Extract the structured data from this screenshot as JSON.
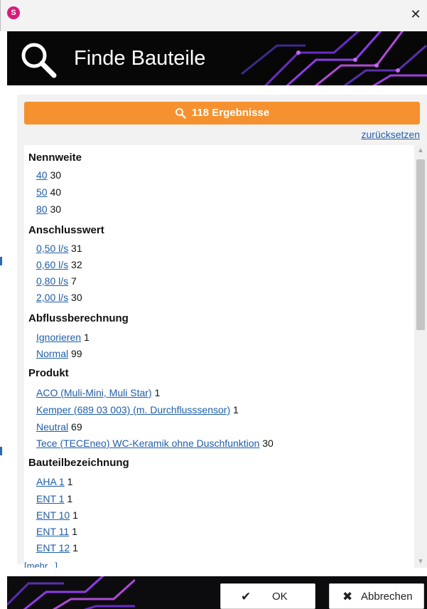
{
  "window": {
    "app_icon_letter": "S",
    "close_glyph": "✕"
  },
  "banner": {
    "title": "Finde Bauteile",
    "icon": "search-icon"
  },
  "results": {
    "label": "118 Ergebnisse",
    "icon": "search-icon",
    "color": "#f5922f"
  },
  "reset_label": "zurücksetzen",
  "groups": [
    {
      "title": "Nennweite",
      "items": [
        {
          "link": "40",
          "count": "30"
        },
        {
          "link": "50",
          "count": "40"
        },
        {
          "link": "80",
          "count": "30"
        }
      ]
    },
    {
      "title": "Anschlusswert",
      "items": [
        {
          "link": "0,50 l/s",
          "count": "31"
        },
        {
          "link": "0,60 l/s",
          "count": "32"
        },
        {
          "link": "0,80 l/s",
          "count": "7"
        },
        {
          "link": "2,00 l/s",
          "count": "30"
        }
      ]
    },
    {
      "title": "Abflussberechnung",
      "items": [
        {
          "link": "Ignorieren",
          "count": "1"
        },
        {
          "link": "Normal",
          "count": "99"
        }
      ]
    },
    {
      "title": "Produkt",
      "items": [
        {
          "link": "ACO (Muli-Mini, Muli Star)",
          "count": "1"
        },
        {
          "link": "Kemper (689 03 003) (m. Durchflusssensor)",
          "count": "1"
        },
        {
          "link": "Neutral",
          "count": "69"
        },
        {
          "link": "Tece (TECEneo) WC-Keramik ohne Duschfunktion",
          "count": "30"
        }
      ]
    },
    {
      "title": "Bauteilbezeichnung",
      "items": [
        {
          "link": "AHA 1",
          "count": "1"
        },
        {
          "link": "ENT 1",
          "count": "1"
        },
        {
          "link": "ENT 10",
          "count": "1"
        },
        {
          "link": "ENT 11",
          "count": "1"
        },
        {
          "link": "ENT 12",
          "count": "1"
        }
      ]
    }
  ],
  "more_label": "[mehr...]",
  "buttons": {
    "ok_label": "OK",
    "ok_icon": "check-icon",
    "cancel_label": "Abbrechen",
    "cancel_icon": "x-icon"
  },
  "colors": {
    "link": "#1f5ea8",
    "banner_bg": "#070708",
    "accent_purple": "#7a2fd6"
  }
}
